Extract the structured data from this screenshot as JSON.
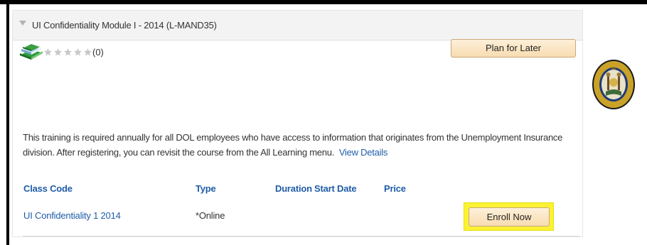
{
  "course": {
    "title": "UI Confidentiality Module I - 2014 (L-MAND35)",
    "rating": {
      "stars": 0,
      "max_stars": 5,
      "count_label": "(0)"
    },
    "plan_button_label": "Plan for Later",
    "description": "This training is required annually for all DOL employees who have access to information that originates from the Unemployment Insurance division. After registering, you can revisit the course from the All Learning menu.",
    "view_details_label": "View Details"
  },
  "classes": {
    "headers": {
      "code": "Class Code",
      "type": "Type",
      "duration": "Duration",
      "start_date": "Start Date",
      "price": "Price"
    },
    "rows": [
      {
        "code": "UI Confidentiality 1 2014",
        "type": "*Online",
        "duration": "",
        "start_date": "",
        "price": "",
        "action": "Enroll Now"
      }
    ]
  },
  "icons": {
    "collapse": "triangle-down-icon",
    "catalog": "books-icon",
    "rating": "star-icon",
    "seal": "nys-dol-seal"
  },
  "colors": {
    "link": "#1f5da8",
    "button": "#f8dcb0",
    "button_border": "#c9a978",
    "highlight": "#fbf233",
    "header_bg": "#f3f3f3"
  }
}
